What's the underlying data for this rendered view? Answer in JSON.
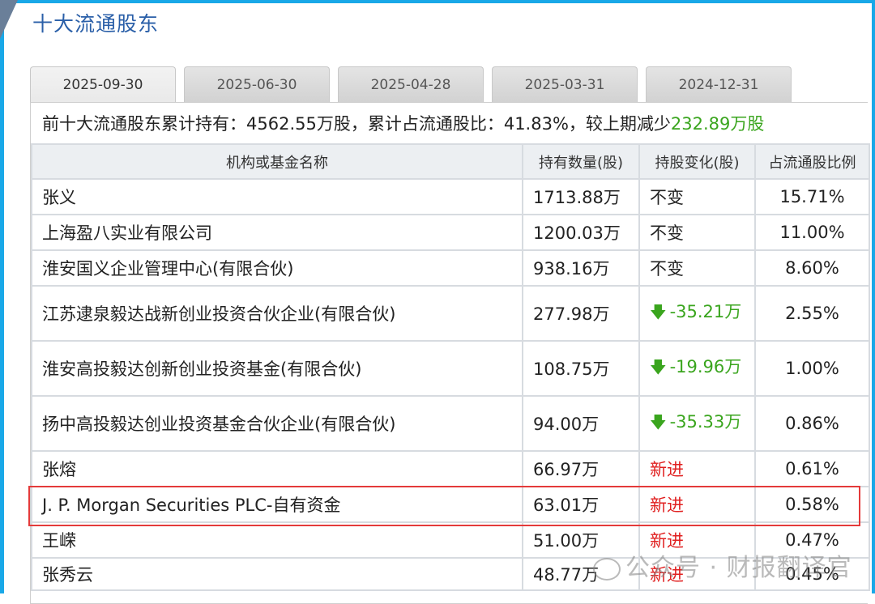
{
  "title": "十大流通股东",
  "tabs": [
    {
      "label": "2025-09-30",
      "active": true
    },
    {
      "label": "2025-06-30",
      "active": false
    },
    {
      "label": "2025-04-28",
      "active": false
    },
    {
      "label": "2025-03-31",
      "active": false
    },
    {
      "label": "2024-12-31",
      "active": false
    }
  ],
  "summary": {
    "prefix": "前十大流通股东累计持有：4562.55万股，累计占流通股比：41.83%，较上期减少",
    "change": "232.89万股"
  },
  "columns": [
    "机构或基金名称",
    "持有数量(股)",
    "持股变化(股)",
    "占流通股比例"
  ],
  "rows": [
    {
      "name": "张义",
      "holding": "1713.88万",
      "change": "不变",
      "change_type": "same",
      "ratio": "15.71%"
    },
    {
      "name": "上海盈八实业有限公司",
      "holding": "1200.03万",
      "change": "不变",
      "change_type": "same",
      "ratio": "11.00%"
    },
    {
      "name": "淮安国义企业管理中心(有限合伙)",
      "holding": "938.16万",
      "change": "不变",
      "change_type": "same",
      "ratio": "8.60%"
    },
    {
      "name": "江苏逮泉毅达战新创业投资合伙企业(有限合伙)",
      "holding": "277.98万",
      "change": "-35.21万",
      "change_type": "down",
      "ratio": "2.55%"
    },
    {
      "name": "淮安高投毅达创新创业投资基金(有限合伙)",
      "holding": "108.75万",
      "change": "-19.96万",
      "change_type": "down",
      "ratio": "1.00%"
    },
    {
      "name": "扬中高投毅达创业投资基金合伙企业(有限合伙)",
      "holding": "94.00万",
      "change": "-35.33万",
      "change_type": "down",
      "ratio": "0.86%"
    },
    {
      "name": "张熔",
      "holding": "66.97万",
      "change": "新进",
      "change_type": "new",
      "ratio": "0.61%"
    },
    {
      "name": "J. P. Morgan Securities PLC-自有资金",
      "holding": "63.01万",
      "change": "新进",
      "change_type": "new",
      "ratio": "0.58%"
    },
    {
      "name": "王嵘",
      "holding": "51.00万",
      "change": "新进",
      "change_type": "new",
      "ratio": "0.47%"
    },
    {
      "name": "张秀云",
      "holding": "48.77万",
      "change": "新进",
      "change_type": "new",
      "ratio": "0.45%"
    }
  ],
  "watermark": "公众号 · 财报翻译官",
  "colors": {
    "accent": "#19a8e8",
    "title": "#2a5fa8",
    "down": "#3aa51e",
    "new": "#e02020",
    "highlight": "#e43a3a"
  }
}
